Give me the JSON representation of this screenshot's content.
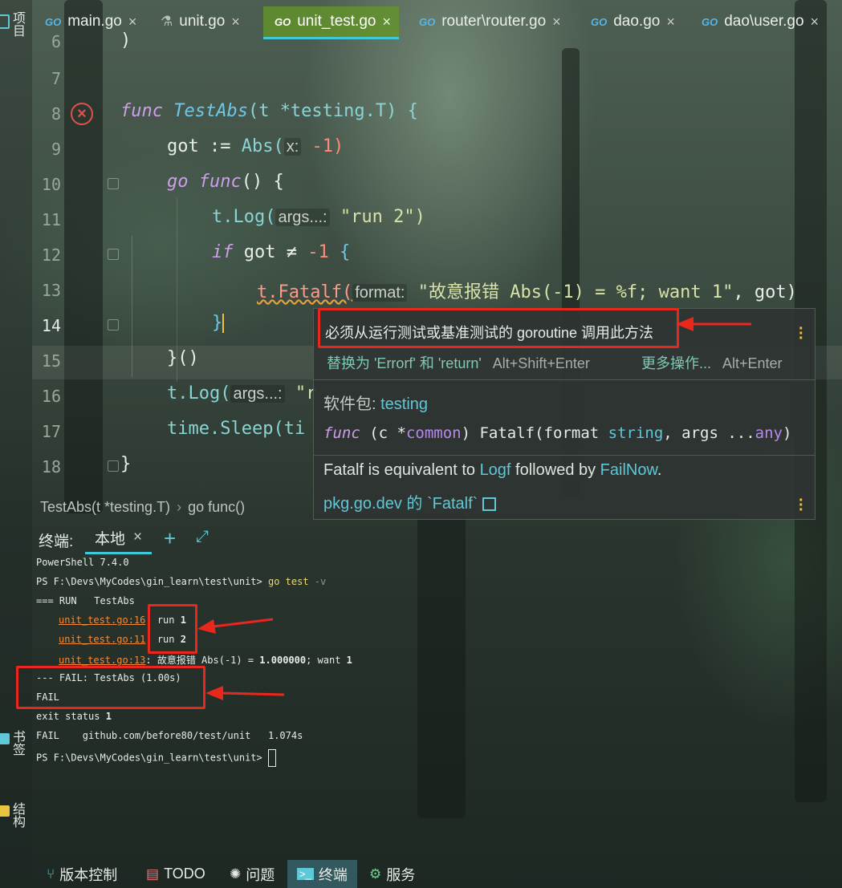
{
  "sidebar": {
    "project": "项目",
    "bookmarks": "书签",
    "structure": "结构"
  },
  "tabs": [
    {
      "icon": "GO",
      "label": "main.go"
    },
    {
      "icon": "test-tube-icon",
      "label": "unit.go"
    },
    {
      "icon": "GO",
      "label": "unit_test.go",
      "active": true
    },
    {
      "icon": "GO",
      "label": "router\\router.go"
    },
    {
      "icon": "GO",
      "label": "dao.go"
    },
    {
      "icon": "GO",
      "label": "dao\\user.go"
    }
  ],
  "editor": {
    "lines": [
      "6",
      "7",
      "8",
      "9",
      "10",
      "11",
      "12",
      "13",
      "14",
      "15",
      "16",
      "17",
      "18"
    ],
    "code": {
      "l6": ")",
      "l8_func": "func",
      "l8_name": "TestAbs",
      "l8_param": "(t *testing.T) {",
      "l9_a": "got := ",
      "l9_fn": "Abs(",
      "l9_hint": "x:",
      "l9_val": " -1)",
      "l10_kw": "go",
      "l10_func": "func",
      "l10_rest": "() {",
      "l11_a": "t.Log(",
      "l11_hint": "args...:",
      "l11_str": " \"run 2\")",
      "l12_kw": "if",
      "l12_rest": " got ≠ ",
      "l12_num": "-1",
      "l12_brace": " {",
      "l13_a": "t.Fatalf(",
      "l13_hint": "format:",
      "l13_str": " \"故意报错 Abs(-1) = %f; want 1\"",
      "l13_rest": ", got)",
      "l14": "}",
      "l15": "}()",
      "l16_a": "t.Log(",
      "l16_hint": "args...:",
      "l16_str": " \"r",
      "l17": "time.Sleep(ti",
      "l18": "}"
    },
    "breadcrumb": [
      "TestAbs(t *testing.T)",
      "go func()"
    ]
  },
  "popup": {
    "error_message": "必须从运行测试或基准测试的 goroutine 调用此方法",
    "fix_action": "替换为 'Errorf' 和 'return'",
    "fix_shortcut": "Alt+Shift+Enter",
    "more_actions": "更多操作...",
    "more_shortcut": "Alt+Enter",
    "package_label": "软件包:",
    "package_name": "testing",
    "signature": {
      "kw": "func",
      "a": " (c *",
      "recv": "common",
      "b": ") Fatalf(format ",
      "t1": "string",
      "c": ", args ...",
      "t2": "any",
      "d": ")"
    },
    "doc": {
      "a": "Fatalf is equivalent to ",
      "link1": "Logf",
      "b": " followed by ",
      "link2": "FailNow",
      "c": "."
    },
    "ext_link": "pkg.go.dev 的 `Fatalf`"
  },
  "terminal": {
    "title": "终端:",
    "tab": "本地",
    "lines": {
      "l1": "PowerShell 7.4.0",
      "l2_prompt": "PS F:\\Devs\\MyCodes\\gin_learn\\test\\unit> ",
      "l2_cmd": "go test",
      "l2_flag": " -v",
      "l3": "=== RUN   TestAbs",
      "l4_link": "unit_test.go:16",
      "l4_rest": ": run ",
      "l4_num": "1",
      "l5_link": "unit_test.go:11",
      "l5_rest": ": run ",
      "l5_num": "2",
      "l6_link": "unit_test.go:13",
      "l6_rest": ": 故意报错 Abs(-1) = ",
      "l6_val": "1.000000",
      "l6_tail": "; want ",
      "l6_num": "1",
      "l7": "--- FAIL: TestAbs (1.00s)",
      "l8": "FAIL",
      "l9_a": "exit status ",
      "l9_num": "1",
      "l10": "FAIL    github.com/before80/test/unit   1.074s",
      "l11": "PS F:\\Devs\\MyCodes\\gin_learn\\test\\unit> "
    }
  },
  "statusbar": [
    {
      "icon": "branch-icon",
      "label": "版本控制"
    },
    {
      "icon": "todo-icon",
      "label": "TODO"
    },
    {
      "icon": "bulb-icon",
      "label": "问题"
    },
    {
      "icon": "terminal-icon",
      "label": "终端",
      "active": true
    },
    {
      "icon": "gear-icon",
      "label": "服务"
    }
  ],
  "colors": {
    "accent": "#3fc8d8",
    "active_tab": "#6a9628",
    "error": "#e2504e",
    "annotation": "#e8281c"
  }
}
